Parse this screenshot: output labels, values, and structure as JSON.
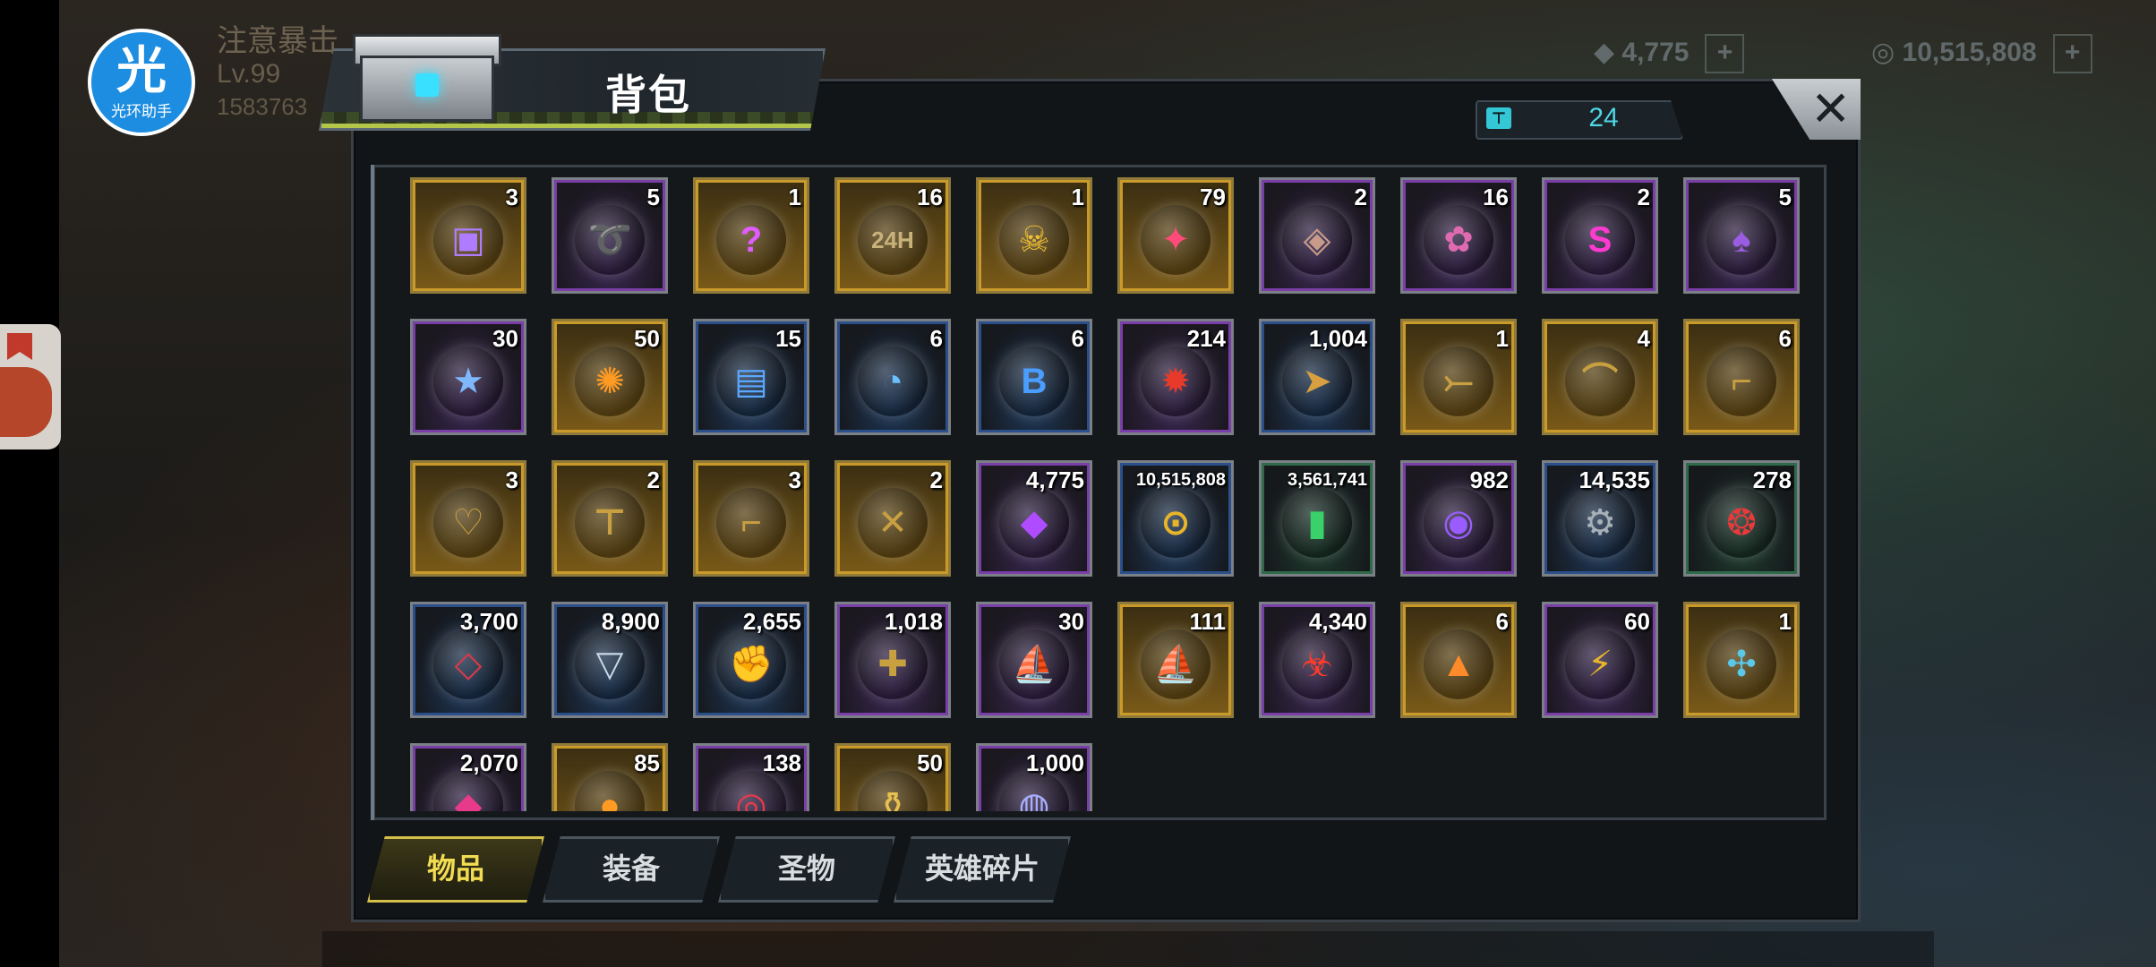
{
  "hud": {
    "player_name": "注意暴击",
    "level": "Lv.99",
    "player_id": "1583763",
    "resource_1": "4,775",
    "resource_2": "10,515,808"
  },
  "helper_badge": {
    "char": "光",
    "label": "光环助手"
  },
  "backpack": {
    "title": "背包",
    "capacity": "24",
    "close_label": "✕"
  },
  "items": [
    {
      "qty": "3",
      "rarity": "gold",
      "icon": "gem-chest-icon",
      "glyph": "▣",
      "color": "#b07cff"
    },
    {
      "qty": "5",
      "rarity": "purple",
      "icon": "cannon-barrel-icon",
      "glyph": "➰",
      "color": "#6ad1ff"
    },
    {
      "qty": "1",
      "rarity": "gold",
      "icon": "gem-cart-icon",
      "glyph": "?",
      "color": "#e05cff"
    },
    {
      "qty": "16",
      "rarity": "gold",
      "icon": "24h-card-icon",
      "glyph": "24H",
      "color": "#c9b27a"
    },
    {
      "qty": "1",
      "rarity": "gold",
      "icon": "golden-skull-icon",
      "glyph": "☠",
      "color": "#f0c030"
    },
    {
      "qty": "79",
      "rarity": "gold",
      "icon": "pink-cap-icon",
      "glyph": "✦",
      "color": "#ff4a7a"
    },
    {
      "qty": "2",
      "rarity": "purple",
      "icon": "cube-frame-icon",
      "glyph": "◈",
      "color": "#c89a8a"
    },
    {
      "qty": "16",
      "rarity": "purple",
      "icon": "film-reel-icon",
      "glyph": "✿",
      "color": "#e06ab0"
    },
    {
      "qty": "2",
      "rarity": "purple",
      "icon": "super-cap-icon",
      "glyph": "S",
      "color": "#ff3ad0"
    },
    {
      "qty": "5",
      "rarity": "purple",
      "icon": "poker-chip-icon",
      "glyph": "♠",
      "color": "#9a5ce0"
    },
    {
      "qty": "30",
      "rarity": "purple",
      "icon": "police-badge-icon",
      "glyph": "★",
      "color": "#7fb8ff"
    },
    {
      "qty": "50",
      "rarity": "gold",
      "icon": "orange-slice-icon",
      "glyph": "✺",
      "color": "#ff9a22"
    },
    {
      "qty": "15",
      "rarity": "blue",
      "icon": "cinema-ticket-icon",
      "glyph": "▤",
      "color": "#5aa8ff"
    },
    {
      "qty": "6",
      "rarity": "blue",
      "icon": "timer-disc-icon",
      "glyph": "◔",
      "color": "#6ac0ff"
    },
    {
      "qty": "6",
      "rarity": "blue",
      "icon": "b-cap-icon",
      "glyph": "B",
      "color": "#4a9eff"
    },
    {
      "qty": "214",
      "rarity": "purple",
      "icon": "red-chip-icon",
      "glyph": "✹",
      "color": "#e83a2a"
    },
    {
      "qty": "1,004",
      "rarity": "blue",
      "icon": "bullet-icon",
      "glyph": "➤",
      "color": "#d8a040"
    },
    {
      "qty": "1",
      "rarity": "gold",
      "icon": "crossbow-card-icon",
      "glyph": "⤚",
      "color": "#c9a040"
    },
    {
      "qty": "4",
      "rarity": "gold",
      "icon": "hat-card-icon",
      "glyph": "⌒",
      "color": "#c9a040"
    },
    {
      "qty": "6",
      "rarity": "gold",
      "icon": "boot-card-icon",
      "glyph": "⌐",
      "color": "#c9a040"
    },
    {
      "qty": "3",
      "rarity": "gold",
      "icon": "gloves-card-icon",
      "glyph": "♡",
      "color": "#c9a040"
    },
    {
      "qty": "2",
      "rarity": "gold",
      "icon": "shirt-card-icon",
      "glyph": "⊤",
      "color": "#c9a040"
    },
    {
      "qty": "3",
      "rarity": "gold",
      "icon": "pistol-card-icon",
      "glyph": "⌐",
      "color": "#c9a040"
    },
    {
      "qty": "2",
      "rarity": "gold",
      "icon": "sword-card-icon",
      "glyph": "✕",
      "color": "#c9a040"
    },
    {
      "qty": "4,775",
      "rarity": "purple",
      "icon": "purple-gem-icon",
      "glyph": "◆",
      "color": "#b04cff"
    },
    {
      "qty": "10,515,808",
      "rarity": "blue",
      "icon": "gold-coins-icon",
      "glyph": "⊙",
      "color": "#e8b52a"
    },
    {
      "qty": "3,561,741",
      "rarity": "green",
      "icon": "green-canister-icon",
      "glyph": "▮",
      "color": "#3ad06a"
    },
    {
      "qty": "982",
      "rarity": "purple",
      "icon": "purple-orb-icon",
      "glyph": "◉",
      "color": "#9a5cff"
    },
    {
      "qty": "14,535",
      "rarity": "blue",
      "icon": "gear-icon",
      "glyph": "⚙",
      "color": "#a8b0b8"
    },
    {
      "qty": "278",
      "rarity": "green",
      "icon": "red-link-badge-icon",
      "glyph": "❂",
      "color": "#e83a3a"
    },
    {
      "qty": "3,700",
      "rarity": "blue",
      "icon": "red-crystal-icon",
      "glyph": "◇",
      "color": "#d83a4a"
    },
    {
      "qty": "8,900",
      "rarity": "blue",
      "icon": "triangle-shard-icon",
      "glyph": "▽",
      "color": "#c8d8e8"
    },
    {
      "qty": "2,655",
      "rarity": "blue",
      "icon": "golden-fist-icon",
      "glyph": "✊",
      "color": "#e0b040"
    },
    {
      "qty": "1,018",
      "rarity": "purple",
      "icon": "puzzle-piece-icon",
      "glyph": "✚",
      "color": "#c8a040"
    },
    {
      "qty": "30",
      "rarity": "purple",
      "icon": "boat-token-icon",
      "glyph": "⛵",
      "color": "#5ab0e8"
    },
    {
      "qty": "111",
      "rarity": "gold",
      "icon": "gold-boat-token-icon",
      "glyph": "⛵",
      "color": "#f0b030"
    },
    {
      "qty": "4,340",
      "rarity": "purple",
      "icon": "biohazard-crystal-icon",
      "glyph": "☣",
      "color": "#ff3a2a"
    },
    {
      "qty": "6",
      "rarity": "gold",
      "icon": "orange-shard-icon",
      "glyph": "▲",
      "color": "#ff8a2a"
    },
    {
      "qty": "60",
      "rarity": "purple",
      "icon": "lightning-coin-icon",
      "glyph": "⚡",
      "color": "#e8b52a"
    },
    {
      "qty": "1",
      "rarity": "gold",
      "icon": "propeller-icon",
      "glyph": "✣",
      "color": "#5ac8e8"
    },
    {
      "qty": "2,070",
      "rarity": "purple",
      "icon": "pink-crystal-icon",
      "glyph": "◆",
      "color": "#e83a8a"
    },
    {
      "qty": "85",
      "rarity": "gold",
      "icon": "orange-token-icon",
      "glyph": "●",
      "color": "#ff9a22"
    },
    {
      "qty": "138",
      "rarity": "purple",
      "icon": "red-target-icon",
      "glyph": "◎",
      "color": "#e83a4a"
    },
    {
      "qty": "50",
      "rarity": "gold",
      "icon": "gold-bottle-icon",
      "glyph": "⚱",
      "color": "#e8c050"
    },
    {
      "qty": "1,000",
      "rarity": "purple",
      "icon": "silver-orb-icon",
      "glyph": "◍",
      "color": "#a8b0ff"
    }
  ],
  "tabs": [
    {
      "label": "物品",
      "active": true
    },
    {
      "label": "装备",
      "active": false
    },
    {
      "label": "圣物",
      "active": false
    },
    {
      "label": "英雄碎片",
      "active": false
    }
  ]
}
